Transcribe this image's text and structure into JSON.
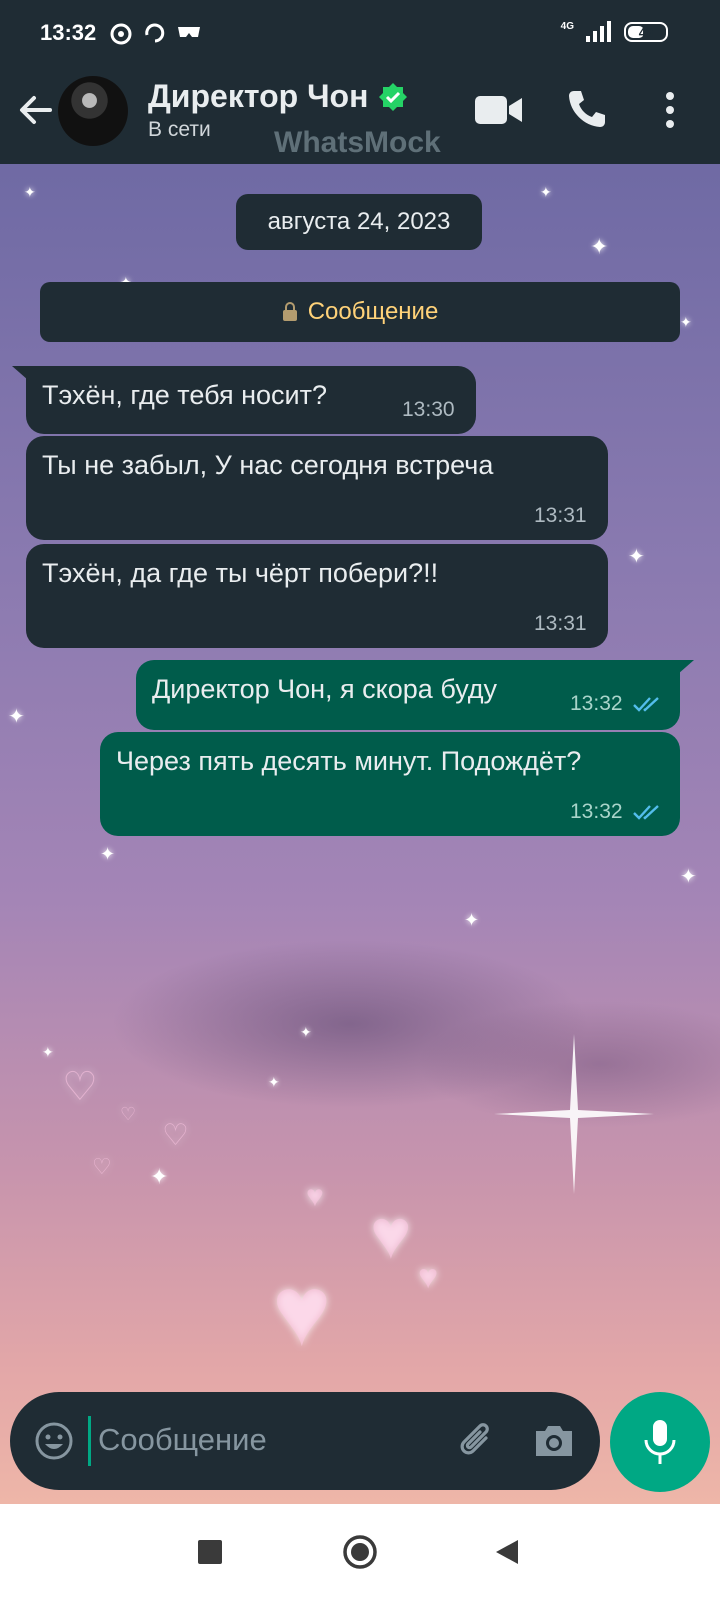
{
  "status_bar": {
    "time": "13:32",
    "network": "4G",
    "battery": "49",
    "battery_level": 0.49
  },
  "header": {
    "contact_name": "Директор Чон",
    "status": "В сети",
    "watermark": "WhatsMock",
    "icons": [
      "back-arrow-icon",
      "verified-icon",
      "video-call-icon",
      "phone-call-icon",
      "more-vert-icon"
    ]
  },
  "chat": {
    "date": "августа 24, 2023",
    "system_message": "Сообщение",
    "messages": [
      {
        "direction": "incoming",
        "text": "Тэхён, где тебя носит?",
        "time": "13:30"
      },
      {
        "direction": "incoming",
        "text": "Ты не забыл, У нас сегодня встреча",
        "time": "13:31"
      },
      {
        "direction": "incoming",
        "text": "Тэхён, да где ты чёрт побери?!!",
        "time": "13:31"
      },
      {
        "direction": "outgoing",
        "text": "Директор Чон, я скора буду",
        "time": "13:32",
        "read": true
      },
      {
        "direction": "outgoing",
        "text": "Через пять десять минут. Подождёт?",
        "time": "13:32",
        "read": true
      }
    ]
  },
  "composer": {
    "placeholder": "Сообщение"
  },
  "colors": {
    "bar": "#1f2c34",
    "incoming_bubble": "#1f2c34",
    "outgoing_bubble": "#005c4b",
    "accent": "#00a884",
    "read_ticks": "#53bdeb",
    "system_text": "#ffd279"
  }
}
